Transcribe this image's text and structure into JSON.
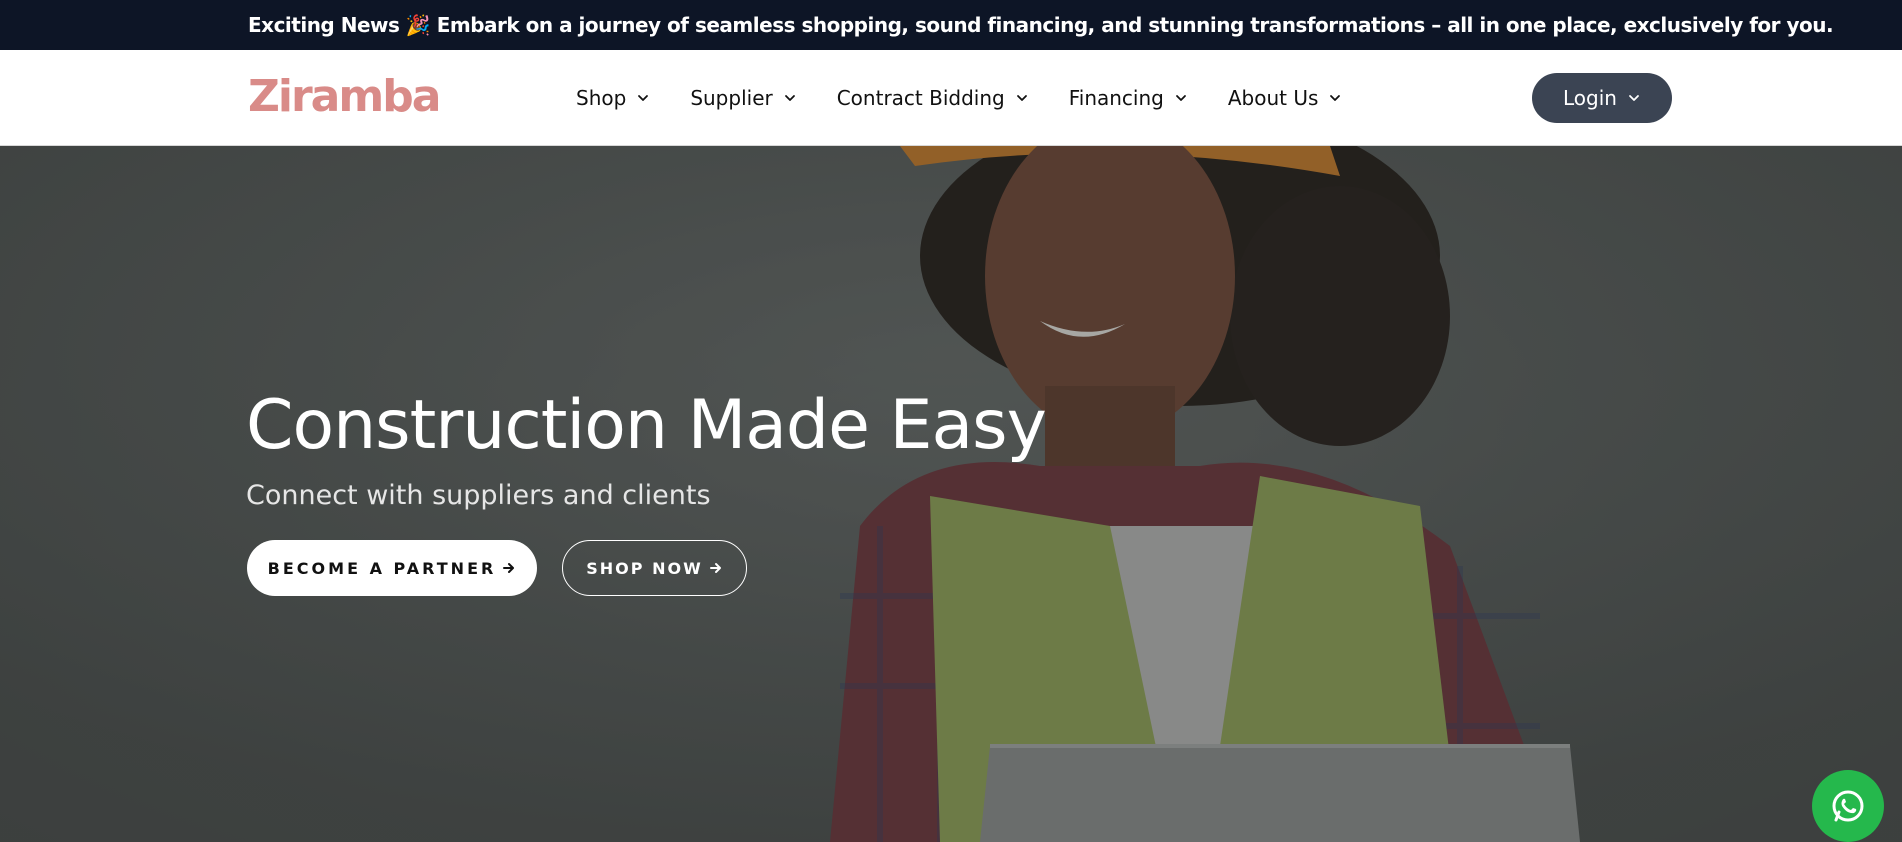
{
  "announcement": {
    "text": "Exciting News 🎉 Embark on a journey of seamless shopping, sound financing, and stunning transformations – all in one place, exclusively for you."
  },
  "header": {
    "logo_text": "Ziramba",
    "nav": [
      {
        "label": "Shop"
      },
      {
        "label": "Supplier"
      },
      {
        "label": "Contract Bidding"
      },
      {
        "label": "Financing"
      },
      {
        "label": "About Us"
      }
    ],
    "login_label": "Login"
  },
  "hero": {
    "title": "Construction Made Easy",
    "subtitle": "Connect with suppliers and clients",
    "partner_button": "BECOME A PARTNER",
    "shop_button": "SHOP NOW"
  },
  "colors": {
    "announce_bg": "#0d1526",
    "logo": "#d98b88",
    "login_bg": "#3b4453",
    "whatsapp": "#25b84c"
  },
  "icons": {
    "nav_dropdown": "chevron-down-icon",
    "button_arrow": "arrow-right-icon",
    "floating": "whatsapp-icon"
  }
}
